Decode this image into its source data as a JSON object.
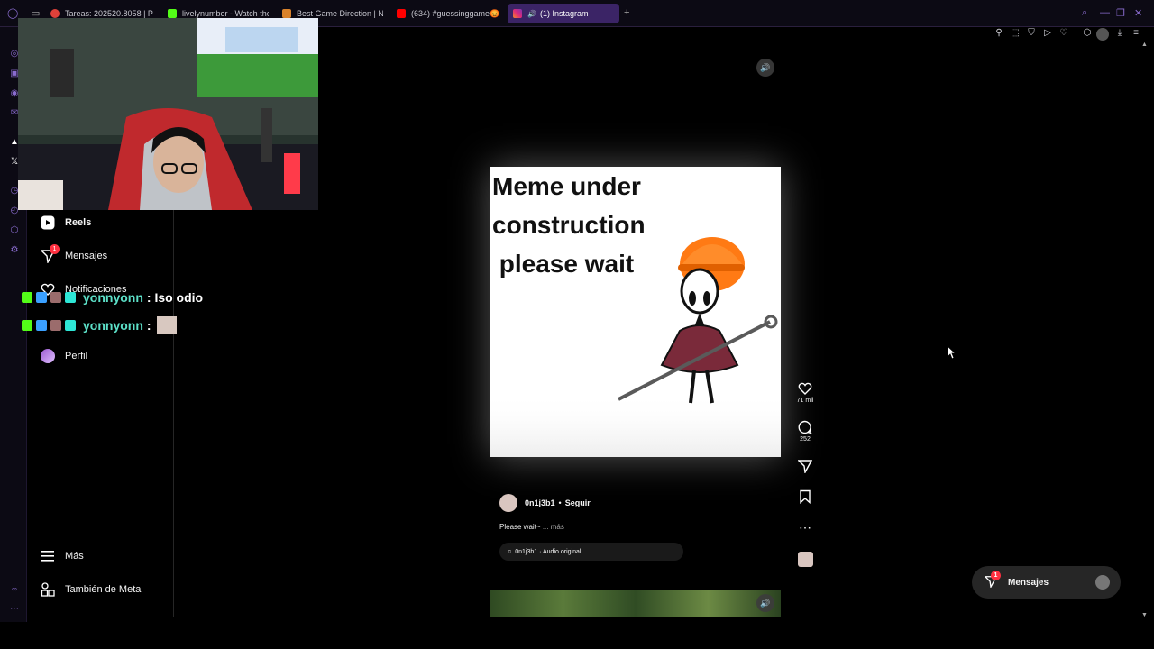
{
  "browser": {
    "tabs": [
      {
        "label": "Tareas: 202520.8058 | P",
        "color": "#e0413a"
      },
      {
        "label": "livelynumber - Watch the",
        "color": "#53fc18"
      },
      {
        "label": "Best Game Direction | No",
        "color": "#d9822b"
      },
      {
        "label": "(634) #guessinggame😡",
        "color": "#ff0000"
      },
      {
        "label": "(1) Instagram",
        "color": "#e1306c"
      }
    ],
    "new_tab": "+"
  },
  "instagram": {
    "nav": {
      "reels": "Reels",
      "messages": "Mensajes",
      "messages_badge": "1",
      "notifications": "Notificaciones",
      "profile": "Perfil",
      "more": "Más",
      "meta": "También de Meta"
    },
    "reel": {
      "meme_lines": [
        "Meme under",
        "construction",
        " please wait"
      ],
      "likes": "71 mil",
      "comments": "252",
      "author": "0n1j3b1",
      "separator": "•",
      "follow": "Seguir",
      "caption": "Please wait~",
      "caption_more": "... más",
      "audio": "0n1j3b1 · Audio original"
    },
    "messages_pill": {
      "label": "Mensajes",
      "badge": "1"
    }
  },
  "chat": [
    {
      "user": "yonnyonn",
      "message": ": Iso odio"
    },
    {
      "user": "yonnyonn",
      "message": ":"
    }
  ],
  "colors": {
    "accent": "#8a6ccf",
    "badge": "#ff3040",
    "chat_user": "#5ce0c8",
    "tab_active": "#3b2466"
  }
}
